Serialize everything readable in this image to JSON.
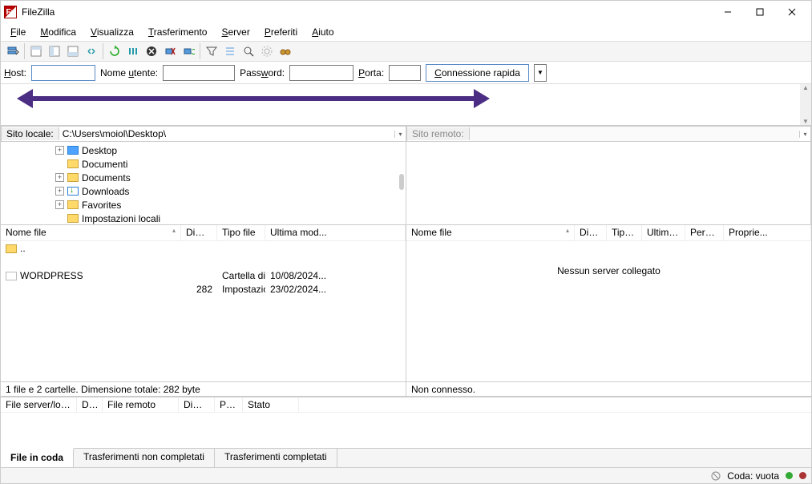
{
  "window": {
    "title": "FileZilla"
  },
  "menu": {
    "file": "File",
    "modifica": "Modifica",
    "visualizza": "Visualizza",
    "trasferimento": "Trasferimento",
    "server": "Server",
    "preferiti": "Preferiti",
    "aiuto": "Aiuto"
  },
  "quickconnect": {
    "host_label": "Host:",
    "user_label": "Nome utente:",
    "pass_label": "Password:",
    "port_label": "Porta:",
    "btn": "Connessione rapida",
    "host": "",
    "user": "",
    "pass": "",
    "port": ""
  },
  "local": {
    "label": "Sito locale:",
    "path": "C:\\Users\\moiol\\Desktop\\",
    "tree": [
      {
        "name": "Desktop",
        "expander": "+",
        "icon": "blue"
      },
      {
        "name": "Documenti",
        "expander": "",
        "icon": "folder"
      },
      {
        "name": "Documents",
        "expander": "+",
        "icon": "folder"
      },
      {
        "name": "Downloads",
        "expander": "+",
        "icon": "dl"
      },
      {
        "name": "Favorites",
        "expander": "+",
        "icon": "folder"
      },
      {
        "name": "Impostazioni locali",
        "expander": "",
        "icon": "folder"
      }
    ],
    "cols": {
      "name": "Nome file",
      "size": "Dimen...",
      "type": "Tipo file",
      "mod": "Ultima mod..."
    },
    "files": [
      {
        "name": "..",
        "size": "",
        "type": "",
        "mod": "",
        "icon": "up"
      },
      {
        "name": "WORDPRESS",
        "size": "",
        "type": "Cartella di file",
        "mod": "10/08/2024...",
        "icon": "folder"
      },
      {
        "name": "",
        "size": "282",
        "type": "Impostazio...",
        "mod": "23/02/2024...",
        "icon": "file"
      }
    ],
    "status": "1 file e 2 cartelle. Dimensione totale: 282 byte"
  },
  "remote": {
    "label": "Sito remoto:",
    "path": "",
    "cols": {
      "name": "Nome file",
      "size": "Dime...",
      "type": "Tipo file",
      "mod": "Ultima m...",
      "perm": "Perme...",
      "owner": "Proprie..."
    },
    "empty": "Nessun server collegato",
    "status": "Non connesso."
  },
  "queue": {
    "cols": {
      "server": "File server/locale",
      "dir": "Dire...",
      "remote": "File remoto",
      "size": "Dimen...",
      "prio": "Prio...",
      "stato": "Stato"
    }
  },
  "tabs": {
    "coda": "File in coda",
    "failed": "Trasferimenti non completati",
    "done": "Trasferimenti completati"
  },
  "statusbar": {
    "queue": "Coda: vuota"
  }
}
